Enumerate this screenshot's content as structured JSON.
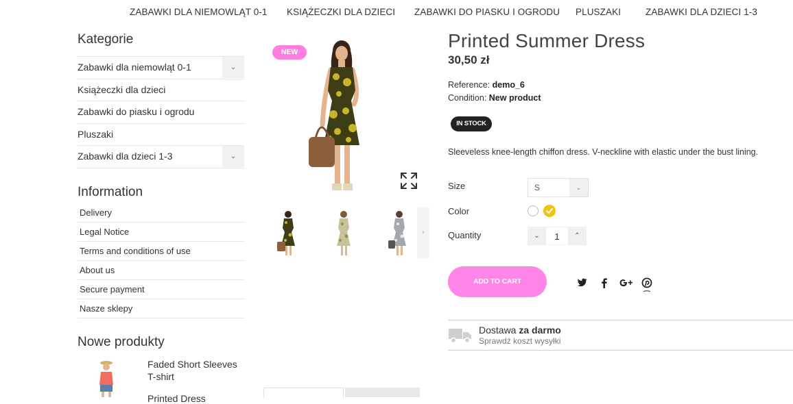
{
  "topnav": {
    "items": [
      "ZABAWKI DLA NIEMOWLĄT 0-1",
      "KSIĄŻECZKI DLA DZIECI",
      "ZABAWKI DO PIASKU I OGRODU",
      "PLUSZAKI",
      "ZABAWKI DLA DZIECI 1-3"
    ]
  },
  "sidebar": {
    "categories_title": "Kategorie",
    "categories": [
      "Zabawki dla niemowląt 0-1",
      "Książeczki dla dzieci",
      "Zabawki do piasku i ogrodu",
      "Pluszaki",
      "Zabawki dla dzieci 1-3"
    ],
    "information_title": "Information",
    "information": [
      "Delivery",
      "Legal Notice",
      "Terms and conditions of use",
      "About us",
      "Secure payment",
      "Nasze sklepy"
    ],
    "new_products_title": "Nowe produkty",
    "new_products": [
      {
        "name": "Faded Short Sleeves T-shirt"
      },
      {
        "name": "Printed Dress"
      }
    ]
  },
  "gallery": {
    "badge": "NEW"
  },
  "product": {
    "title": "Printed Summer Dress",
    "price": "30,50 zł",
    "reference_label": "Reference:",
    "reference_value": "demo_6",
    "condition_label": "Condition:",
    "condition_value": "New product",
    "stock": "IN STOCK",
    "description": "Sleeveless knee-length chiffon dress. V-neckline with elastic under the bust lining.",
    "size_label": "Size",
    "size_value": "S",
    "color_label": "Color",
    "colors": [
      "#ffffff",
      "#f1c40f"
    ],
    "quantity_label": "Quantity",
    "quantity_value": "1",
    "add_to_cart": "ADD TO CART"
  },
  "shipping": {
    "title_prefix": "Dostawa",
    "title_bold": "za darmo",
    "subtitle": "Sprawdź koszt wysyłki"
  },
  "colors": {
    "accent_pink": "#ff85e8",
    "badge_pink": "#ff7ee0",
    "stock_bg": "#222222",
    "swatch_yellow": "#f1c40f"
  }
}
